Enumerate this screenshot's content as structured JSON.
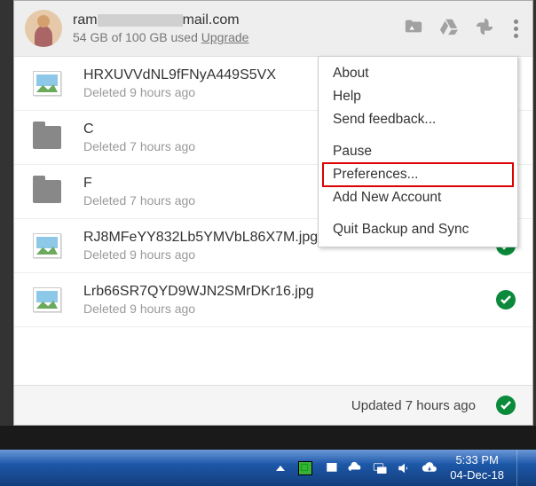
{
  "header": {
    "email_prefix": "ram",
    "email_suffix": "mail.com",
    "storage_text": "54 GB of 100 GB used",
    "upgrade_label": "Upgrade"
  },
  "files": [
    {
      "name": "HRXUVVdNL9fFNyA449S5VX",
      "sub": "Deleted 9 hours ago",
      "type": "image",
      "synced": false
    },
    {
      "name": "C",
      "sub": "Deleted 7 hours ago",
      "type": "folder",
      "synced": false
    },
    {
      "name": "F",
      "sub": "Deleted 7 hours ago",
      "type": "folder",
      "synced": true
    },
    {
      "name": "RJ8MFeYY832Lb5YMVbL86X7M.jpg",
      "sub": "Deleted 9 hours ago",
      "type": "image",
      "synced": true
    },
    {
      "name": "Lrb66SR7QYD9WJN2SMrDKr16.jpg",
      "sub": "Deleted 9 hours ago",
      "type": "image",
      "synced": true
    }
  ],
  "footer": {
    "text": "Updated 7 hours ago"
  },
  "menu": {
    "about": "About",
    "help": "Help",
    "feedback": "Send feedback...",
    "pause": "Pause",
    "preferences": "Preferences...",
    "add_account": "Add New Account",
    "quit": "Quit Backup and Sync"
  },
  "taskbar": {
    "time": "5:33 PM",
    "date": "04-Dec-18"
  }
}
